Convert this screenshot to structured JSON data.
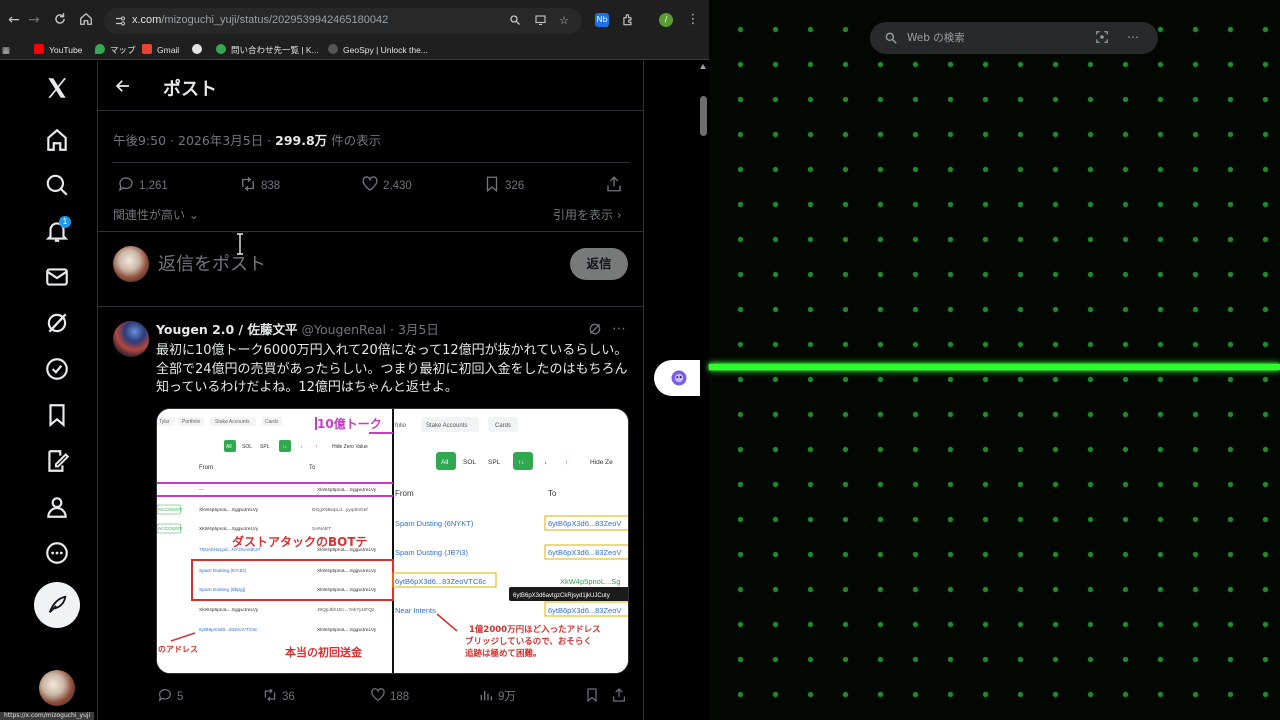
{
  "browser": {
    "url_host": "x.com",
    "url_path": "/mizoguchi_yuji/status/2029539942465180042",
    "bookmarks": [
      {
        "label": "YouTube",
        "color": "#ff0000"
      },
      {
        "label": "マップ",
        "color": "#34a853"
      },
      {
        "label": "Gmail",
        "color": "#ea4335"
      },
      {
        "label": "",
        "color": "#e3e3e3"
      },
      {
        "label": "問い合わせ先一覧 | K...",
        "color": "#34a853"
      },
      {
        "label": "GeoSpy | Unlock the...",
        "color": "#555555"
      }
    ],
    "status_url": "https://x.com/mizoguchi_yuji",
    "extension_label": "Nb",
    "profile_initial": "/"
  },
  "x": {
    "page_title": "ポスト",
    "notification_count": "1",
    "post": {
      "time": "午後9:50",
      "date": "2026年3月5日",
      "views_number": "299.8万",
      "views_suffix": "件の表示",
      "replies": "1,261",
      "reposts": "838",
      "likes": "2,430",
      "bookmarks": "326",
      "relevance_label": "関連性が高い",
      "quote_link": "引用を表示"
    },
    "reply_box": {
      "placeholder": "返信をポスト",
      "button": "返信"
    },
    "reply_tweet": {
      "name": "Yougen 2.0 / 佐藤文平",
      "handle": "@YougenReal",
      "date": "3月5日",
      "text": "最初に10億トーク6000万円入れて20倍になって12億円が抜かれているらしい。全部で24億円の売買があったらしい。つまり最初に初回入金をしたのはもちろん知っているわけだよね。12億円はちゃんと返せよ。",
      "replies": "5",
      "reposts": "36",
      "likes": "188",
      "views": "9万",
      "media": {
        "left_tabs": [
          "Tybz",
          "Portfolio",
          "Stake Accounts",
          "Cards"
        ],
        "left_filters": [
          "All",
          "SOL",
          "SPL"
        ],
        "left_hide_zero": "Hide Zero Value",
        "from_label": "From",
        "to_label": "To",
        "left_rows": [
          {
            "badge": "",
            "from": "—",
            "to": "XkW4p5pnoL...SggwJreLVy"
          },
          {
            "badge": "ACCOUNT",
            "from": "XkW4p5pnoL...SggwJreLVy",
            "to": "DGgX55wpLd...yyqdmGef"
          },
          {
            "badge": "ACCOUNT",
            "from": "XkW4p5pnoL...SggwJreLVy",
            "to": "SANAET"
          },
          {
            "badge": "",
            "from": "75NAbHvLpd...NY2ScedK3T",
            "to": "XkW4p5pnoL...SggwJreLVy"
          },
          {
            "badge": "",
            "from": "Spam Dusting (67c8z)",
            "to": "XkW4p5pnoL...SggwJreLVy"
          },
          {
            "badge": "",
            "from": "Spam Dusting (8bpgj)",
            "to": "XkW4p5pnoL...SggwJreLVy"
          },
          {
            "badge": "",
            "from": "XkW4p5pnoL...SggwJreLVy",
            "to": "J9QpJbh1Ec...7ek7y1tFQz"
          },
          {
            "badge": "",
            "from": "6ytB6pX3d6...83ZeoVTC6c",
            "to": "XkW4p5pnoL...SggwJreLVy"
          }
        ],
        "ann_10oku": "10億トーク",
        "ann_dust": "ダストアタックのBOTテ",
        "ann_address": "のアドレス",
        "ann_first_deposit": "本当の初回送金",
        "right_tabs": [
          "folio",
          "Stake Accounts",
          "Cards"
        ],
        "right_filters": [
          "All",
          "SOL",
          "SPL"
        ],
        "right_hide_zero": "Hide Ze",
        "right_rows": [
          {
            "from": "Spam Dusting (6NYKT)",
            "to": "6ytB6pX3d6...83ZeoV"
          },
          {
            "from": "Spam Dusting (JB7i3)",
            "to": "6ytB6pX3d6...83ZeoV"
          },
          {
            "from": "6ytB6pX3d6...83ZeoVTC6c",
            "to": "XkW4p5pnoL...Sg"
          },
          {
            "from": "Near Intents",
            "to": "6ytB6pX3d6...83ZeoV"
          }
        ],
        "tooltip": "6ytB6pX3d6avtgzCkRjsyd1jkUJCuty",
        "ann_right_1": "1億2000万円ほど入ったアドレス",
        "ann_right_2": "ブリッジしているので、おそらく",
        "ann_right_3": "追跡は極めて困難。"
      }
    }
  },
  "right_panel": {
    "search_placeholder": "Web の検索",
    "dot_color": "#1e8a2a",
    "line_color": "#2cff2c"
  },
  "colors": {
    "x_blue": "#1d9bf0",
    "text_primary": "#e7e9ea",
    "text_secondary": "#71767b"
  }
}
